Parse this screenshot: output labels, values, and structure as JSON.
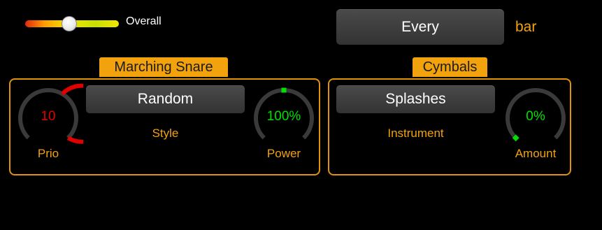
{
  "overall": {
    "label": "Overall",
    "level": 0.47
  },
  "rhythm": {
    "every_button": "Every",
    "unit_label": "bar"
  },
  "marching_snare": {
    "title": "Marching Snare",
    "style_button": "Random",
    "style_label": "Style",
    "prio": {
      "value": "10",
      "label": "Prio",
      "fraction": 1.0,
      "color": "#e00000"
    },
    "power": {
      "value": "100%",
      "label": "Power",
      "fraction": 0.5,
      "color": "#00e000"
    }
  },
  "cymbals": {
    "title": "Cymbals",
    "instrument_button": "Splashes",
    "instrument_label": "Instrument",
    "amount": {
      "value": "0%",
      "label": "Amount",
      "fraction": 0.0,
      "color": "#00e000"
    }
  },
  "colors": {
    "accent": "#f2a20d",
    "background": "#000000",
    "button": "#3a3a3a"
  }
}
